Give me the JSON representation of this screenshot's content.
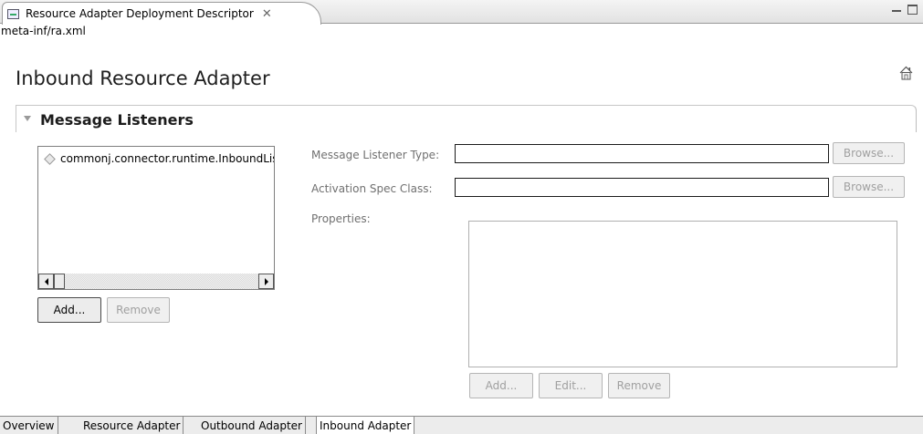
{
  "editor": {
    "tab_title": "Resource Adapter Deployment Descriptor",
    "tab_close": "✕",
    "file_path": "meta-inf/ra.xml"
  },
  "page": {
    "title": "Inbound Resource Adapter"
  },
  "section": {
    "title": "Message Listeners"
  },
  "listeners": {
    "items": [
      "commonj.connector.runtime.InboundListener"
    ],
    "add_label": "Add...",
    "remove_label": "Remove"
  },
  "details": {
    "message_listener_type_label": "Message Listener Type:",
    "message_listener_type_value": "",
    "activation_spec_class_label": "Activation Spec Class:",
    "activation_spec_class_value": "",
    "browse_label": "Browse...",
    "properties_label": "Properties:",
    "props_add_label": "Add...",
    "props_edit_label": "Edit...",
    "props_remove_label": "Remove"
  },
  "page_tabs": [
    "Overview",
    "Resource Adapter",
    "Outbound Adapter",
    "Inbound Adapter"
  ],
  "active_page_tab": "Inbound Adapter"
}
